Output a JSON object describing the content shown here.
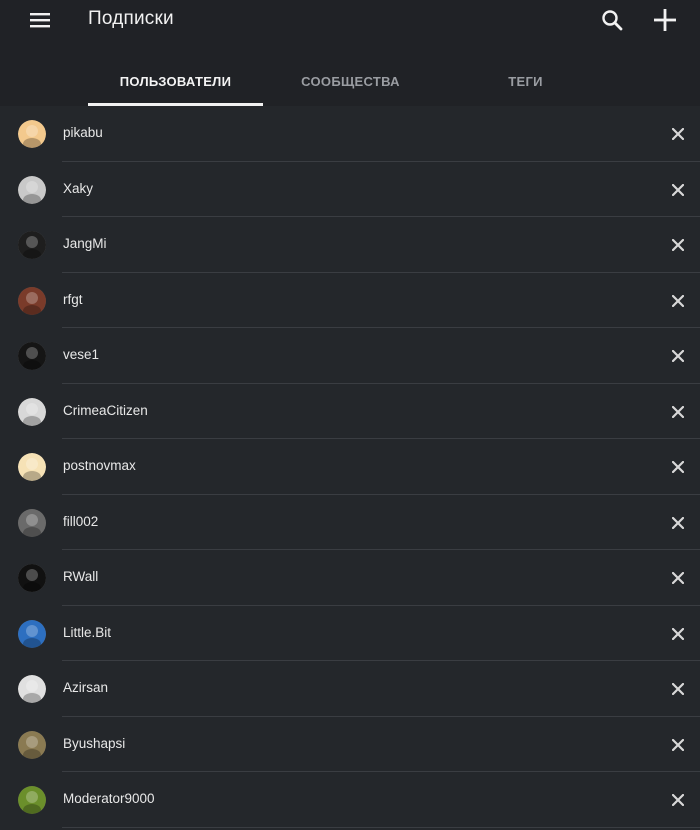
{
  "header": {
    "title": "Подписки",
    "menu_icon": "hamburger-menu-icon",
    "search_icon": "search-icon",
    "add_icon": "plus-icon"
  },
  "tabs": [
    {
      "label": "ПОЛЬЗОВАТЕЛИ",
      "active": true
    },
    {
      "label": "СООБЩЕСТВА",
      "active": false
    },
    {
      "label": "ТЕГИ",
      "active": false
    }
  ],
  "users": [
    {
      "name": "pikabu",
      "avatar_color": "#f3c98d"
    },
    {
      "name": "Xaky",
      "avatar_color": "#c9c9c9"
    },
    {
      "name": "JangMi",
      "avatar_color": "#1e1e1e"
    },
    {
      "name": "rfgt",
      "avatar_color": "#7a3b2a"
    },
    {
      "name": "vese1",
      "avatar_color": "#151515"
    },
    {
      "name": "CrimeaCitizen",
      "avatar_color": "#d8d8d8"
    },
    {
      "name": "postnovmax",
      "avatar_color": "#f6e2b6"
    },
    {
      "name": "fill002",
      "avatar_color": "#6a6a6a"
    },
    {
      "name": "RWall",
      "avatar_color": "#111111"
    },
    {
      "name": "Little.Bit",
      "avatar_color": "#2d6fc0"
    },
    {
      "name": "Azirsan",
      "avatar_color": "#e0e0e0"
    },
    {
      "name": "Byushapsi",
      "avatar_color": "#8a7a52"
    },
    {
      "name": "Moderator9000",
      "avatar_color": "#6b8f2b"
    }
  ],
  "remove_icon": "close-icon",
  "colors": {
    "background": "#24272b",
    "header": "#202226",
    "divider": "#3a3d42",
    "text": "#e8e8e8",
    "inactive_tab": "#9a9da2"
  }
}
